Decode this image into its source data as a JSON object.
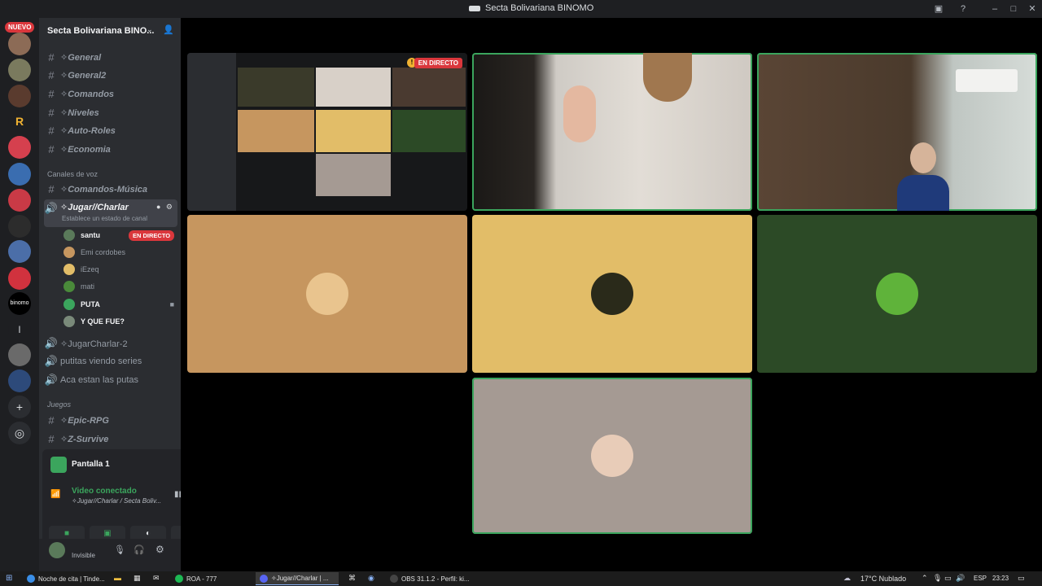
{
  "window": {
    "title": "Secta Bolivariana BINOMO"
  },
  "rail": {
    "new_badge": "NUEVO",
    "server_letter": "l"
  },
  "server": {
    "name": "Secta Bolivariana BINO..."
  },
  "text_channels": [
    {
      "name": "✧General"
    },
    {
      "name": "✧General2"
    },
    {
      "name": "✧Comandos"
    },
    {
      "name": "✧Niveles"
    },
    {
      "name": "✧Auto-Roles"
    },
    {
      "name": "✧Economia"
    }
  ],
  "voice_category": "Canales de voz",
  "voice_channels": {
    "music": "✧Comandos-Música",
    "active": "✧Jugar//Charlar",
    "active_status": "Establece un estado de canal",
    "other": [
      {
        "name": "✧JugarCharlar-2"
      },
      {
        "name": "putitas viendo series"
      },
      {
        "name": "Aca estan las putas"
      }
    ]
  },
  "voice_users": [
    {
      "name": "santu",
      "live": "EN DIRECTO"
    },
    {
      "name": "Emi cordobes"
    },
    {
      "name": "iEzeq"
    },
    {
      "name": "mati"
    },
    {
      "name": "PUTA"
    },
    {
      "name": "Y QUE FUE?"
    }
  ],
  "games_category": "Juegos",
  "game_channels": [
    {
      "name": "✧Epic-RPG"
    },
    {
      "name": "✧Z-Survive"
    }
  ],
  "screen_panel": {
    "label": "Pantalla 1"
  },
  "voice_panel": {
    "status": "Video conectado",
    "location": "✧Jugar//Charlar / Secta Boliv..."
  },
  "userbar": {
    "status": "Invisible"
  },
  "stage": {
    "live_label": "EN DIRECTO"
  },
  "tile_colors": {
    "tan": "#c6965f",
    "yellow": "#e2bd68",
    "green": "#2c4a26",
    "mauve": "#a59a93"
  },
  "taskbar": {
    "tasks": [
      {
        "label": "Noche de cita | Tinde..."
      },
      {
        "label": "ROA - 777"
      },
      {
        "label": "✧Jugar//Charlar | ..."
      },
      {
        "label": "OBS 31.1.2 - Perfil: ki..."
      }
    ],
    "weather": "17°C  Nublado",
    "lang": "ESP",
    "time": "23:23"
  }
}
